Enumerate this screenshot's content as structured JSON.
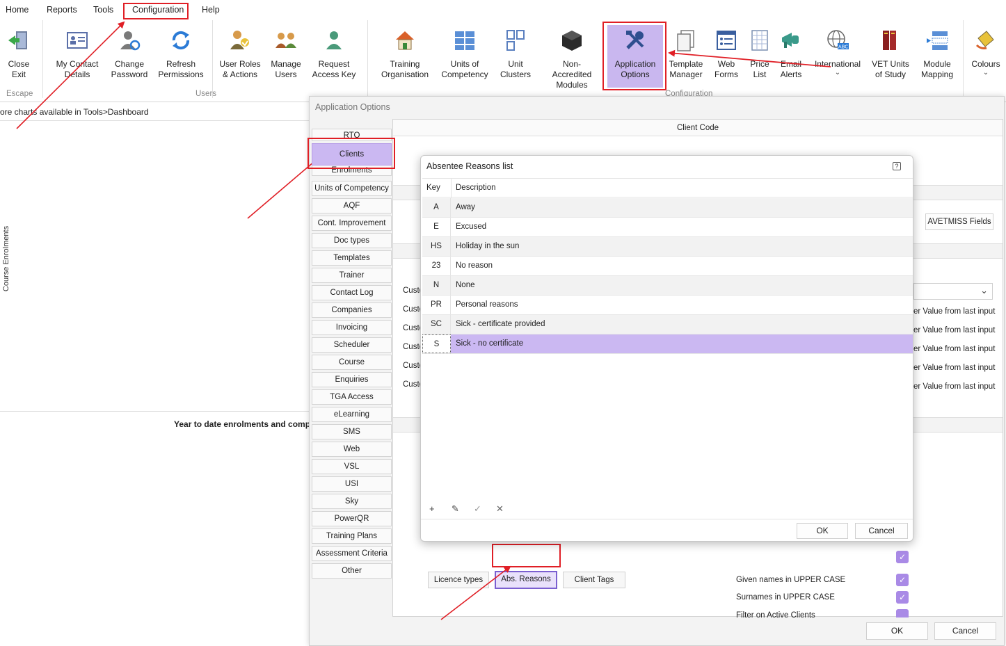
{
  "menu": {
    "items": [
      "Home",
      "Reports",
      "Tools",
      "Configuration",
      "Help"
    ]
  },
  "ribbon": {
    "buttons": [
      {
        "label": "Close\nExit",
        "icon": "close-exit-icon"
      },
      {
        "label": "My Contact\nDetails",
        "icon": "contact-card-icon"
      },
      {
        "label": "Change\nPassword",
        "icon": "change-password-icon"
      },
      {
        "label": "Refresh\nPermissions",
        "icon": "refresh-icon"
      },
      {
        "label": "User Roles\n& Actions",
        "icon": "user-roles-icon"
      },
      {
        "label": "Manage\nUsers",
        "icon": "manage-users-icon"
      },
      {
        "label": "Request\nAccess Key",
        "icon": "request-key-icon"
      },
      {
        "label": "Training\nOrganisation",
        "icon": "house-icon"
      },
      {
        "label": "Units of\nCompetency",
        "icon": "units-grid-icon"
      },
      {
        "label": "Unit\nClusters",
        "icon": "clusters-icon"
      },
      {
        "label": "Non-Accredited\nModules",
        "icon": "cube-icon"
      },
      {
        "label": "Application\nOptions",
        "icon": "tools-icon"
      },
      {
        "label": "Template\nManager",
        "icon": "template-icon"
      },
      {
        "label": "Web\nForms",
        "icon": "web-forms-icon"
      },
      {
        "label": "Price\nList",
        "icon": "price-list-icon"
      },
      {
        "label": "Email\nAlerts",
        "icon": "megaphone-icon"
      },
      {
        "label": "International",
        "icon": "globe-icon"
      },
      {
        "label": "VET Units\nof Study",
        "icon": "books-icon"
      },
      {
        "label": "Module\nMapping",
        "icon": "module-mapping-icon"
      },
      {
        "label": "Colours",
        "icon": "paint-bucket-icon"
      }
    ],
    "groups": {
      "escape": "Escape",
      "users": "Users",
      "configuration": "Configuration"
    }
  },
  "dashboard": {
    "hint": "ore charts available in Tools>Dashboard",
    "vertical_label": "Course Enrolments",
    "ytd_title": "Year to date enrolments and comp"
  },
  "app_options": {
    "title": "Application Options",
    "tabs": [
      "RTO",
      "Clients",
      "Enrolments",
      "Units of Competency",
      "AQF",
      "Cont. Improvement",
      "Doc types",
      "Templates",
      "Trainer",
      "Contact Log",
      "Companies",
      "Invoicing",
      "Scheduler",
      "Course",
      "Enquiries",
      "TGA Access",
      "eLearning",
      "SMS",
      "Web",
      "VSL",
      "USI",
      "Sky",
      "PowerQR",
      "Training Plans",
      "Assessment Criteria",
      "Other"
    ],
    "selected_tab": "Clients",
    "panel_header": "Client Code",
    "avetmiss_button": "AVETMISS Fields",
    "custom_labels": [
      "Custo",
      "Custo",
      "Custo",
      "Custo",
      "Custo",
      "Custo"
    ],
    "last_input_labels": [
      "er Value from last input",
      "er Value from last input",
      "er Value from last input",
      "er Value from last input",
      "er Value from last input"
    ],
    "bottom_buttons": {
      "licence": "Licence types",
      "abs": "Abs. Reasons",
      "tags": "Client Tags"
    },
    "options": [
      {
        "label": "Given names in UPPER CASE",
        "checked": true
      },
      {
        "label": "Surnames in UPPER CASE",
        "checked": true
      },
      {
        "label": "Filter on Active Clients",
        "checked": true
      }
    ],
    "ok": "OK",
    "cancel": "Cancel"
  },
  "absentee_dialog": {
    "title": "Absentee Reasons list",
    "help_icon": "?",
    "columns": {
      "key": "Key",
      "description": "Description"
    },
    "rows": [
      {
        "key": "A",
        "description": "Away"
      },
      {
        "key": "E",
        "description": "Excused"
      },
      {
        "key": "HS",
        "description": "Holiday in the sun"
      },
      {
        "key": "23",
        "description": "No reason"
      },
      {
        "key": "N",
        "description": "None"
      },
      {
        "key": "PR",
        "description": "Personal reasons"
      },
      {
        "key": "SC",
        "description": "Sick - certificate provided"
      },
      {
        "key": "S",
        "description": "Sick - no certificate"
      }
    ],
    "selected_row_key": "S",
    "nav": {
      "add": "+",
      "edit": "✎",
      "post": "✓",
      "cancel": "✕"
    },
    "ok": "OK",
    "cancel": "Cancel"
  },
  "colors": {
    "accent_purple": "#cbb8f2",
    "checkbox_purple": "#a98ae6",
    "annotation_red": "#e01f26"
  }
}
